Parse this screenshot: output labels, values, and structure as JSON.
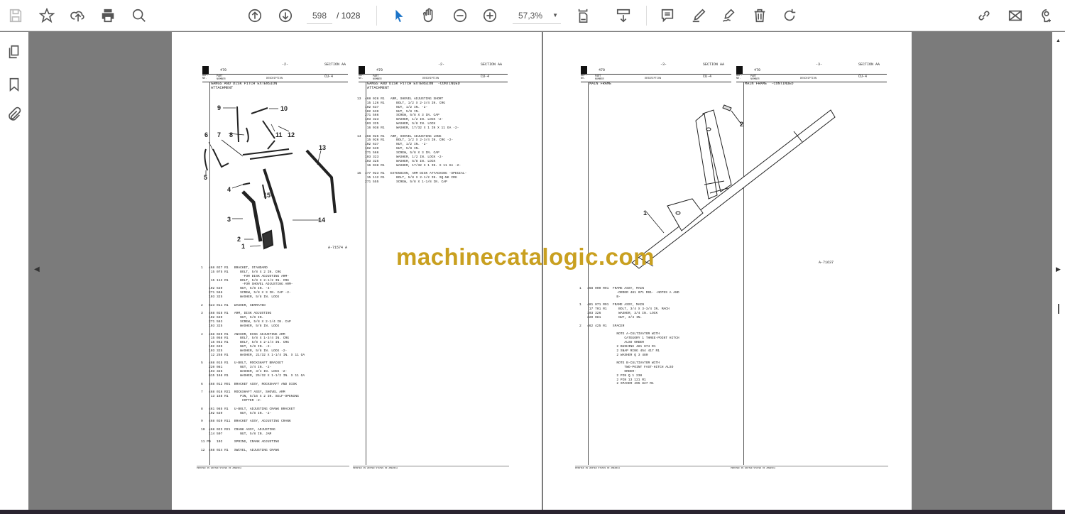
{
  "toolbar": {
    "current_page": "598",
    "total_pages": "/ 1028",
    "zoom": "57,3%"
  },
  "watermark": "machinecatalogic.com",
  "pages": [
    {
      "model": "470",
      "page_no": "-2-",
      "section": "SECTION AA",
      "code": "CU-4",
      "ref_label": "REF. NO.",
      "part_label": "PART NUMBER",
      "desc_label": "DESCRIPTION",
      "title": "GANGS AND DISK PITCH EXTENSION\nATTACHMENT",
      "figure": "A-71574 A",
      "footer": "PRINTED IN UNITED STATES OF AMERICA",
      "list": "1   468 027 R1   BRACKET, STANDARD\n     15 075 R1      BOLT, 5/8 X 2 IN. CRG\n                     -FOR DISK ADJUSTING ARM-\n     15 112 R1      BOLT, 5/8 X 2-1/2 IN. CRG\n                     -FOR SHOVEL ADJUSTING ARM-\n    102 639         NUT, 5/8 IN. -4-\n    271 566         SCREW, 5/8 X 3 IN. CAP -2-\n    103 325         WASHER, 5/8 IN. LOCK\n\n2   523 011 R1   WASHER, SERRATED\n\n3   468 028 R1   ARM, DISK ADJUSTING\n    102 639         NUT, 5/8 IN.\n    271 563         SCREW, 5/8 X 2-1/4 IN. CAP\n    103 325         WASHER, 5/8 IN. LOCK\n\n4   468 029 R1   ANCHOR, DISK ADJUSTING ARM\n     15 058 R1      BOLT, 5/8 X 1-3/4 IN. CRG\n     15 043 R1      BOLT, 5/8 X 2-1/4 IN. CRG\n    102 639         NUT, 5/8 IN. -2-\n    103 325         WASHER, 5/8 IN. LOCK -2-\n     12 258 R1      WASHER, 21/32 X 1-1/4 IN. X 11 GA\n\n5   468 015 R1   U-BOLT, ROCKSHAFT BRACKET\n    220 081         NUT, 3/4 IN. -2-\n    103 326         WASHER, 3/4 IN. LOCK -2-\n    615 168 R1      WASHER, 25/32 X 1-1/2 IN. X 11 GA\n\n6   468 012 R91  BRACKET ASSY, ROCKSHAFT AND DISK\n\n7   468 016 R21  ROCKSHAFT ASSY, SHOVEL ARM\n     13 158 R1      PIN, 5/16 X 2 IN. SELF-OPENING\n                     COTTER -2-\n\n8   461 985 R1   U-BOLT, ADJUSTING CRANK BRACKET\n    102 639         NUT, 5/8 IN. -2-\n\n9   468 020 R11  BRACKET ASSY, ADJUSTING CRANK\n\n10  468 023 R21  CRANK ASSY, ADJUSTING\n    114 507         NUT, 5/8 IN. JAM\n\n11 PD   102      SPRING, CRANK ADJUSTING\n\n12  468 024 R1   SWIVEL, ADJUSTING CRANK"
    },
    {
      "model": "470",
      "page_no": "-2-",
      "section": "SECTION AA",
      "code": "CU-4",
      "ref_label": "REF. NO.",
      "part_label": "PART NUMBER",
      "desc_label": "DESCRIPTION",
      "title": "GANGS AND DISK PITCH EXTENSION  -CONTINUED\nATTACHMENT",
      "footer": "PRINTED IN UNITED STATES OF AMERICA",
      "list": "13  468 026 R1   ARM, SHOVEL ADJUSTING SHORT\n     15 126 R1      BOLT, 1/2 X 2-3/4 IN. CRG\n    102 637         NUT, 1/2 IN. -2-\n    102 639         NUT, 5/8 IN.\n    271 566         SCREW, 5/8 X 3 IN. CAP\n    103 323         WASHER, 1/2 IN. LOCK -2-\n    103 325         WASHER, 5/8 IN. LOCK\n     16 038 R1      WASHER, 17/32 X 1 IN X 11 GA -2-\n\n14  468 025 R1   ARM, SHOVEL ADJUSTING LONG\n     15 026 R1      BOLT, 1/2 X 2-3/4 IN. CRG -2-\n    102 637         NUT, 1/2 IN. -2-\n    102 639         NUT, 5/8 IN.\n    271 566         SCREW, 5/8 X 3 IN. CAP\n    103 323         WASHER, 1/2 IN. LOCK -2-\n    103 325         WASHER, 5/8 IN. LOCK\n     16 038 R1      WASHER, 17/32 X 1 IN. X 11 GA -2-\n\n15  477 023 R1   EXTENSION, ARM DISK ATTACHING -SPECIAL-\n     15 112 R1      BOLT, 5/8 X 2-1/2 IN. SQ-NK CRG\n    271 555         SCREW, 5/8 X 1-1/8 IN. CAP"
    },
    {
      "model": "470",
      "page_no": "-3-",
      "section": "SECTION AA",
      "code": "CU-4",
      "ref_label": "REF. NO.",
      "part_label": "PART NUMBER",
      "desc_label": "DESCRIPTION",
      "title": "MAIN FRAME",
      "figure": "A-71637",
      "footer": "PRINTED IN UNITED STATES OF AMERICA",
      "list": "1   468 000 R91  FRAME ASSY, MAIN\n                   -ORDER 481 071 R91- -NOTES A AND\n                   B-\n\n1   481 071 R91  FRAME ASSY, MAIN\n     17 701 R1      BOLT, 3/4 X 3-3/4 IN. MACH\n    103 326         WASHER, 3/4 IN. LOCK\n    220 081         NUT, 3/4 IN.\n\n2   462 425 R1   SPACER\n\n                   NOTE A-CULTIVATOR WITH\n                       CATEGORY 1 THREE-POINT HITCH\n                       ALSO ORDER\n                   2 BUSHING 481 074 R1\n                   2 SNAP RING 454 417 R1\n                   2 WASHER Q 3 480\n\n                   NOTE B-CULTIVATOR WITH\n                       TWO-POINT FAST-HITCH ALSO\n                       ORDER-\n                   2 PIN Q 1 238\n                   2 PIN 13 121 R1\n                   2 SPACER 495 827 R1"
    },
    {
      "model": "470",
      "page_no": "-3-",
      "section": "SECTION AA",
      "code": "CU-4",
      "ref_label": "REF. NO.",
      "part_label": "PART NUMBER",
      "desc_label": "DESCRIPTION",
      "title": "MAIN FRAME  -CONTINUED",
      "footer": "PRINTED IN UNITED STATES OF AMERICA",
      "list": ""
    }
  ],
  "callouts_left": [
    "1",
    "2",
    "3",
    "4",
    "5",
    "6",
    "7",
    "8",
    "9",
    "10",
    "11",
    "12",
    "13",
    "14",
    "15"
  ],
  "callouts_right": [
    "1",
    "2"
  ]
}
